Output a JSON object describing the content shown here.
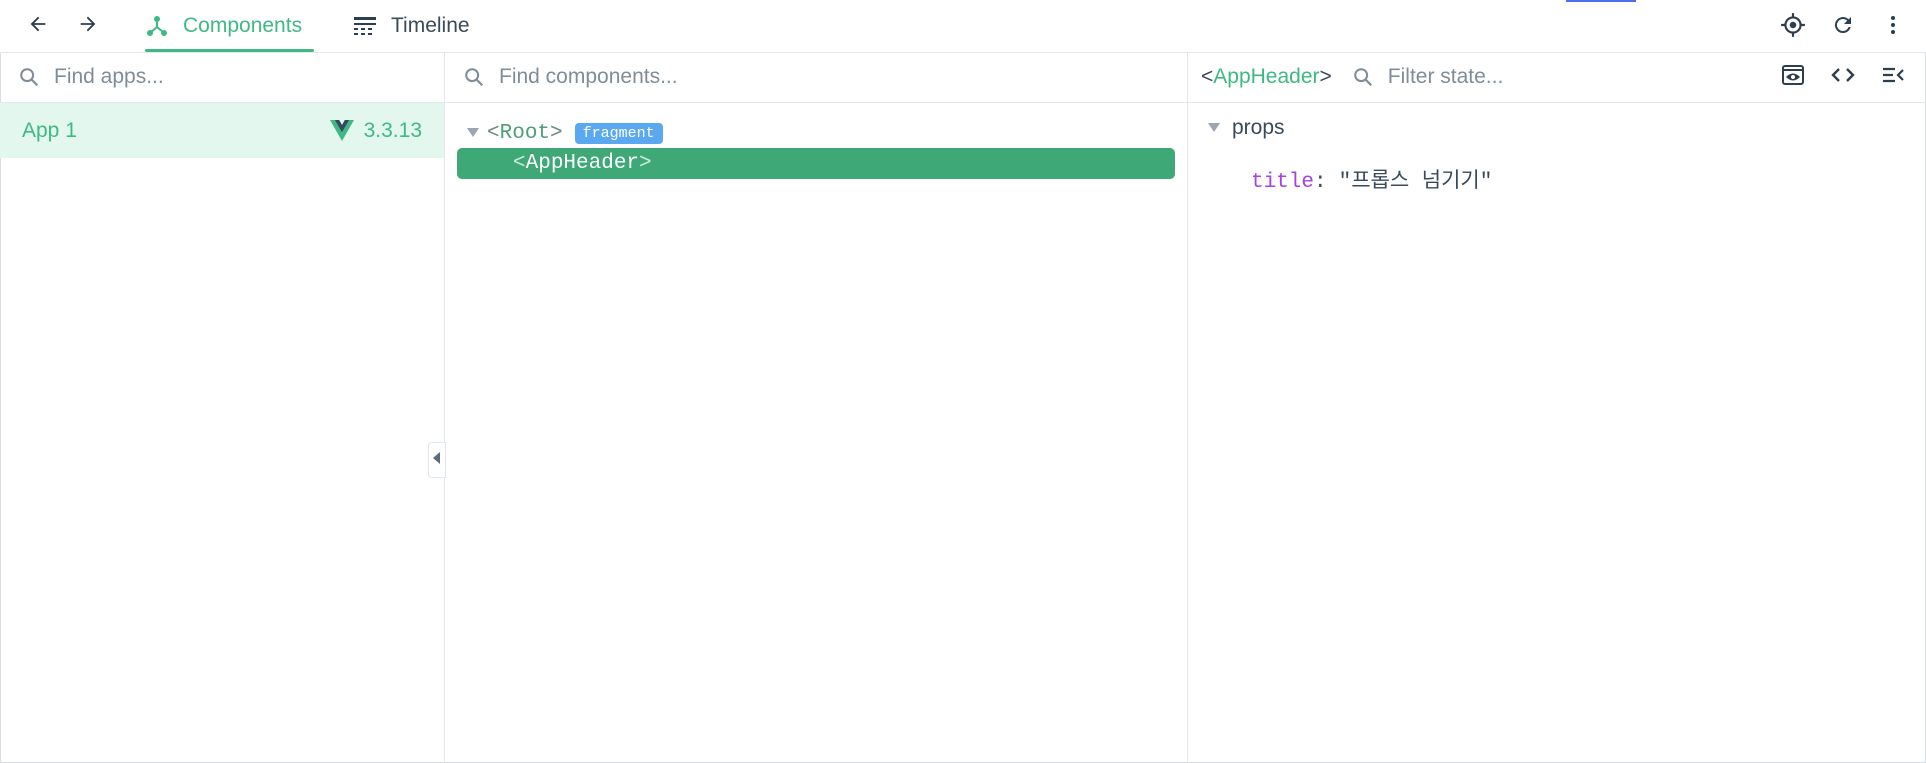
{
  "toolbar": {
    "tabs": [
      {
        "label": "Components",
        "active": true,
        "icon": "components-icon"
      },
      {
        "label": "Timeline",
        "active": false,
        "icon": "timeline-icon"
      }
    ],
    "accent_color": "#3fb983"
  },
  "apps_pane": {
    "search_placeholder": "Find apps...",
    "apps": [
      {
        "name": "App 1",
        "version": "3.3.13",
        "icon": "vue-logo-icon"
      }
    ]
  },
  "components_pane": {
    "search_placeholder": "Find components...",
    "tree": [
      {
        "name": "Root",
        "open": "<",
        "close": ">",
        "badge": "fragment",
        "expanded": true,
        "selected": false
      },
      {
        "name": "AppHeader",
        "open": "<",
        "close": ">",
        "selected": true
      }
    ]
  },
  "inspector": {
    "component_open": "<",
    "component_name": "AppHeader",
    "component_close": ">",
    "filter_placeholder": "Filter state...",
    "section_title": "props",
    "props": [
      {
        "key": "title",
        "value": "\"프롭스 넘기기\""
      }
    ]
  }
}
